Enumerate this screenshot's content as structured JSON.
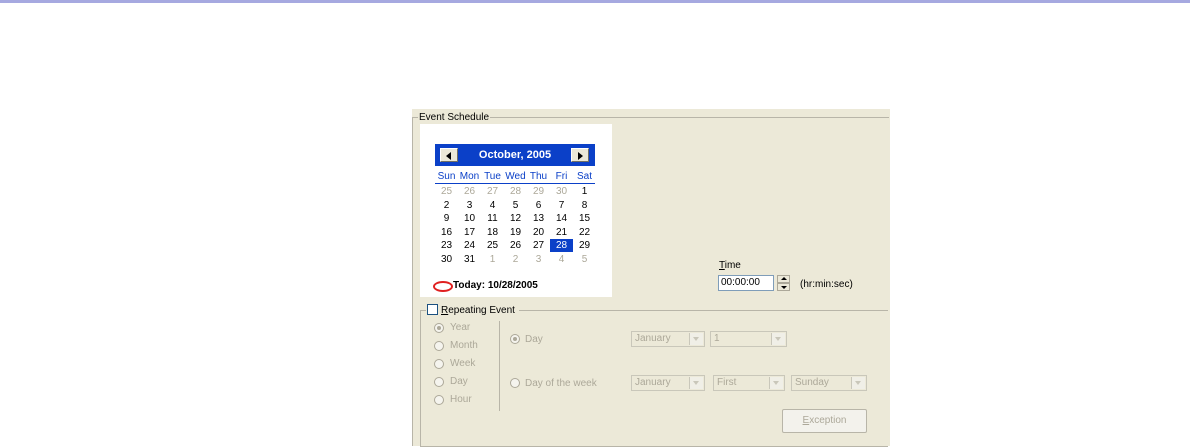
{
  "event_schedule": {
    "title": "Event Schedule",
    "calendar": {
      "month_title": "October, 2005",
      "prev_icon": "triangle-left-icon",
      "next_icon": "triangle-right-icon",
      "day_headers": [
        "Sun",
        "Mon",
        "Tue",
        "Wed",
        "Thu",
        "Fri",
        "Sat"
      ],
      "weeks": [
        [
          "25",
          "26",
          "27",
          "28",
          "29",
          "30",
          "1"
        ],
        [
          "2",
          "3",
          "4",
          "5",
          "6",
          "7",
          "8"
        ],
        [
          "9",
          "10",
          "11",
          "12",
          "13",
          "14",
          "15"
        ],
        [
          "16",
          "17",
          "18",
          "19",
          "20",
          "21",
          "22"
        ],
        [
          "23",
          "24",
          "25",
          "26",
          "27",
          "28",
          "29"
        ],
        [
          "30",
          "31",
          "1",
          "2",
          "3",
          "4",
          "5"
        ]
      ],
      "selected_day": "28",
      "today_label": "Today: 10/28/2005",
      "accent_color": "#0b40c8",
      "today_marker_color": "#e02020"
    },
    "time": {
      "label": "Time",
      "value": "00:00:00",
      "format_hint": "(hr:min:sec)"
    },
    "repeating": {
      "checkbox_label": "Repeating Event",
      "checked": false,
      "periods": [
        "Year",
        "Month",
        "Week",
        "Day",
        "Hour"
      ],
      "selected_period": "Year",
      "day_option": {
        "label": "Day",
        "month_value": "January",
        "day_value": "1"
      },
      "dow_option": {
        "label": "Day of the week",
        "month_value": "January",
        "ordinal_value": "First",
        "weekday_value": "Sunday"
      },
      "exception_button": "Exception"
    }
  }
}
